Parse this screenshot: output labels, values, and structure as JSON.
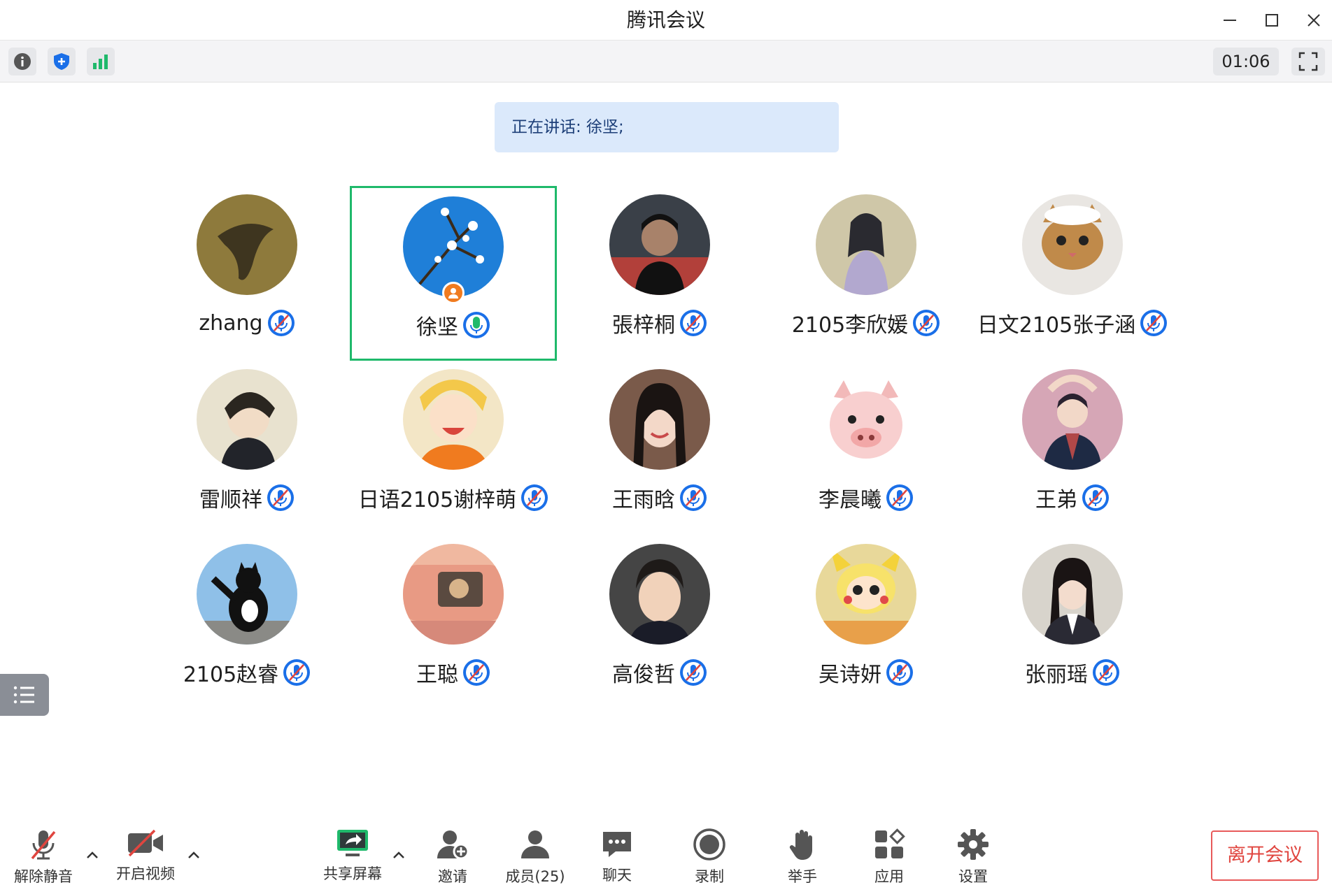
{
  "window": {
    "title": "腾讯会议"
  },
  "toolbar": {
    "timer": "01:06"
  },
  "banner": {
    "text": "正在讲话: 徐坚;"
  },
  "participants": [
    {
      "name": "zhang",
      "mic": "muted",
      "avatar": "bird-sepia"
    },
    {
      "name": "徐坚",
      "mic": "speaking",
      "avatar": "plum-blossom",
      "host": true,
      "active": true
    },
    {
      "name": "張梓桐",
      "mic": "muted",
      "avatar": "anime-boy-flowers"
    },
    {
      "name": "2105李欣媛",
      "mic": "muted",
      "avatar": "painted-girl"
    },
    {
      "name": "日文2105张子涵",
      "mic": "muted",
      "avatar": "cat-in-snow"
    },
    {
      "name": "雷顺祥",
      "mic": "muted",
      "avatar": "anime-boy"
    },
    {
      "name": "日语2105谢梓萌",
      "mic": "muted",
      "avatar": "cartoon-blonde"
    },
    {
      "name": "王雨晗",
      "mic": "muted",
      "avatar": "smiling-girl"
    },
    {
      "name": "李晨曦",
      "mic": "muted",
      "avatar": "pig-face"
    },
    {
      "name": "王弟",
      "mic": "muted",
      "avatar": "boy-heart-hands"
    },
    {
      "name": "2105赵睿",
      "mic": "muted",
      "avatar": "cat-waving"
    },
    {
      "name": "王聪",
      "mic": "muted",
      "avatar": "dog-in-car"
    },
    {
      "name": "高俊哲",
      "mic": "muted",
      "avatar": "young-boy"
    },
    {
      "name": "吴诗妍",
      "mic": "muted",
      "avatar": "crayon-shin-pikachu"
    },
    {
      "name": "张丽瑶",
      "mic": "muted",
      "avatar": "girl-uniform"
    }
  ],
  "bottom": {
    "unmute": "解除静音",
    "video": "开启视频",
    "share": "共享屏幕",
    "invite": "邀请",
    "members": "成员(25)",
    "chat": "聊天",
    "record": "录制",
    "raise_hand": "举手",
    "apps": "应用",
    "settings": "设置",
    "leave": "离开会议"
  },
  "colors": {
    "accent_blue": "#1a6fe8",
    "active_border": "#1fb96b",
    "leave_red": "#e0453f",
    "banner_bg": "#dbe9fb"
  }
}
